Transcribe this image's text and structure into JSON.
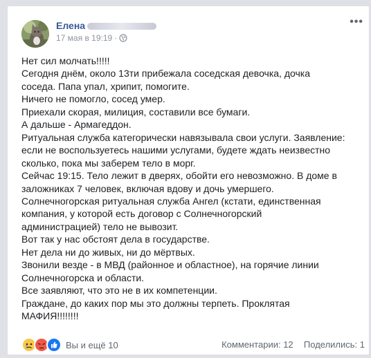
{
  "post": {
    "author": "Елена",
    "date": "17 мая в 19:19",
    "separator": "·",
    "lines": [
      "Нет сил молчать!!!!!",
      "Сегодня днём, около 13ти прибежала соседская девочка, дочка",
      "соседа. Папа упал, хрипит, помогите.",
      "Ничего не помогло, сосед умер.",
      "Приехали скорая, милиция, составили все бумаги.",
      "А дальше - Армагеддон.",
      "Ритуальная служба категорически навязывала свои услуги. Заявление:",
      "если не воспользуетесь нашими услугами, будете ждать неизвестно",
      "сколько, пока мы заберем тело в морг.",
      "Сейчас 19:15. Тело лежит в дверях, обойти его невозможно. В доме в",
      "заложниках 7 человек, включая вдову и дочь умершего.",
      "Солнечногорская ритуальная служба Ангел (кстати, единственная",
      "компания, у которой есть договор с Солнечногорский",
      "администрацией) тело не вывозит.",
      "Вот так у нас обстоят дела в государстве.",
      "Нет дела ни до живых, ни до мёртвых.",
      "Звонили везде - в МВД (районное и областное), на горячие линии",
      "Солнечногорска и области.",
      "Все заявляют, что это не в их компетенции.",
      "Граждане, до каких пор мы это должны терпеть. Проклятая",
      "МАФИЯ!!!!!!!!"
    ]
  },
  "footer": {
    "reactions_text": "Вы и ещё 10",
    "comments": "Комментарии: 12",
    "shares": "Поделились: 1",
    "reaction_icons": [
      "sad-icon",
      "angry-icon",
      "like-icon"
    ]
  },
  "colors": {
    "author": "#385898",
    "meta": "#8d949e",
    "like": "#1877f2",
    "angry": "#f0584a",
    "sad": "#f7c84a"
  }
}
